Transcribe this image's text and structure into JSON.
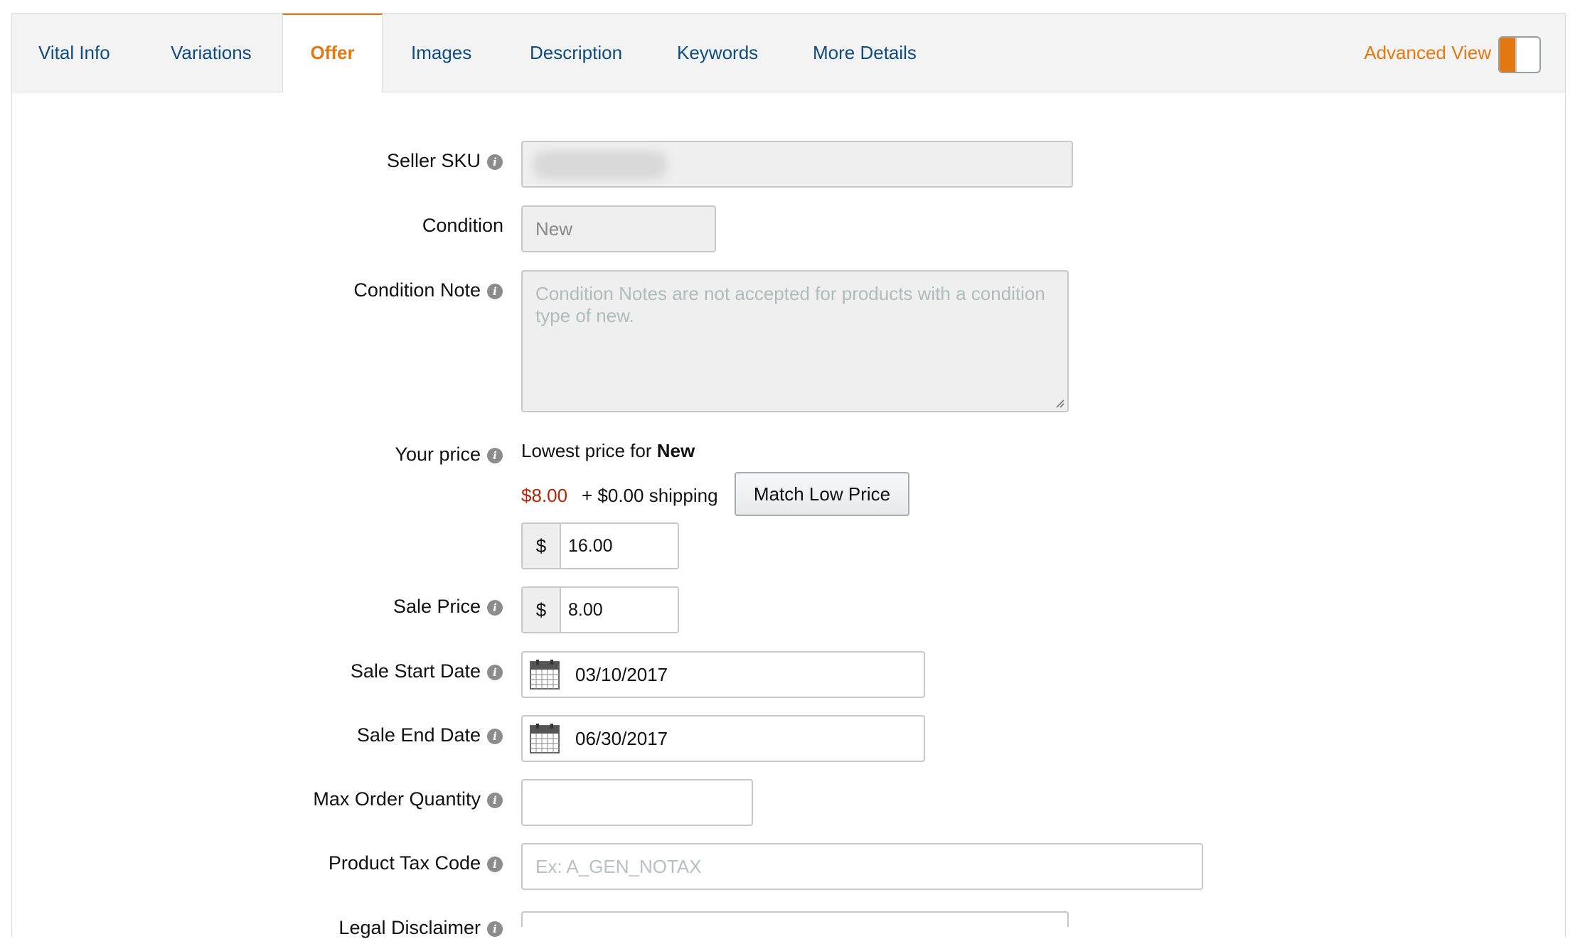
{
  "tabs": [
    {
      "label": "Vital Info"
    },
    {
      "label": "Variations"
    },
    {
      "label": "Offer"
    },
    {
      "label": "Images"
    },
    {
      "label": "Description"
    },
    {
      "label": "Keywords"
    },
    {
      "label": "More Details"
    }
  ],
  "active_tab": "Offer",
  "advanced_view": {
    "label": "Advanced View",
    "enabled": true
  },
  "colors": {
    "accent": "#e47911",
    "link": "#0f4c81",
    "low_price": "#b12704"
  },
  "form": {
    "seller_sku": {
      "label": "Seller SKU",
      "value": ""
    },
    "condition": {
      "label": "Condition",
      "value": "New"
    },
    "condition_note": {
      "label": "Condition Note",
      "placeholder": "Condition Notes are not accepted for products with a condition type of new."
    },
    "your_price": {
      "label": "Your price",
      "lowest_prefix": "Lowest price for",
      "lowest_condition": "New",
      "low_price": "$8.00",
      "shipping": "+ $0.00 shipping",
      "match_button": "Match Low Price",
      "currency": "$",
      "value": "16.00"
    },
    "sale_price": {
      "label": "Sale Price",
      "currency": "$",
      "value": "8.00"
    },
    "sale_start_date": {
      "label": "Sale Start Date",
      "value": "03/10/2017"
    },
    "sale_end_date": {
      "label": "Sale End Date",
      "value": "06/30/2017"
    },
    "max_order_quantity": {
      "label": "Max Order Quantity",
      "value": ""
    },
    "product_tax_code": {
      "label": "Product Tax Code",
      "placeholder": "Ex: A_GEN_NOTAX"
    },
    "legal_disclaimer": {
      "label": "Legal Disclaimer"
    }
  }
}
